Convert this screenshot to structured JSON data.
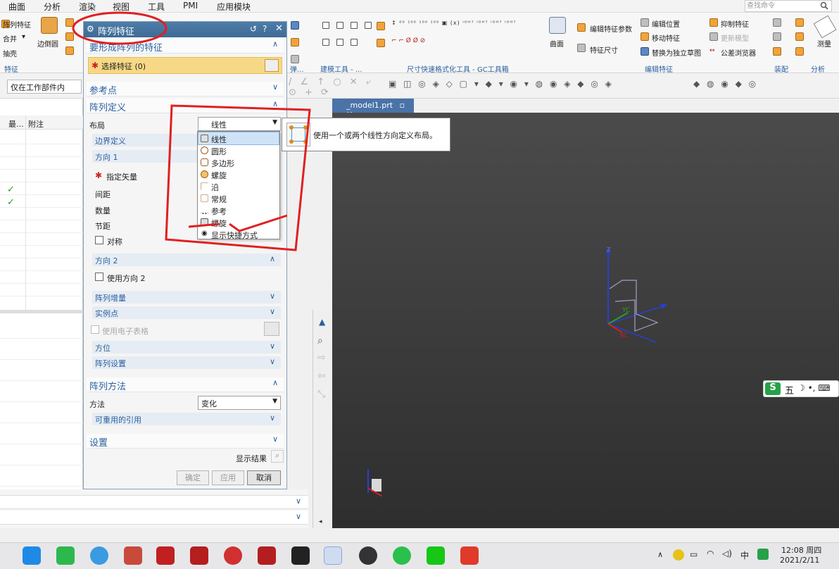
{
  "menubar": {
    "items": [
      "曲面",
      "分析",
      "渲染",
      "视图",
      "工具",
      "PMI",
      "应用模块"
    ],
    "search_placeholder": "查找命令"
  },
  "ribbon": {
    "feature_items": [
      "阵列特征",
      "合并",
      "抽壳"
    ],
    "edge_blend": "边倒圆",
    "group_feature": "特征",
    "group_synchronous": "弹...",
    "group_modeling": "建模工具 - ...",
    "group_gc": "尺寸快速格式化工具 - GC工具箱",
    "surface": "曲面",
    "edit_params": "编辑特征参数",
    "feature_dims": "特征尺寸",
    "edit_position": "编辑位置",
    "move_feature": "移动特征",
    "replace_sketch": "替换为独立草图",
    "suppress": "抑制特征",
    "update_model": "更新模型",
    "tolerance_browser": "公差浏览器",
    "group_edit_feature": "编辑特征",
    "group_assembly": "装配",
    "group_analysis": "分析",
    "measure": "测量"
  },
  "filter": {
    "value": "仅在工作部件内"
  },
  "nav": {
    "col_last": "最...",
    "col_note": "附注"
  },
  "dialog": {
    "title": "阵列特征",
    "sec_features": "要形成阵列的特征",
    "select_feature": "选择特征 (0)",
    "sec_reference": "参考点",
    "sec_definition": "阵列定义",
    "layout_label": "布局",
    "layout_value": "线性",
    "boundary": "边界定义",
    "direction1": "方向 1",
    "specify_vector": "指定矢量",
    "spacing": "间距",
    "count": "数量",
    "pitch": "节距",
    "symmetric": "对称",
    "direction2": "方向 2",
    "use_dir2": "使用方向 2",
    "increment": "阵列增量",
    "instance_point": "实例点",
    "use_spreadsheet": "使用电子表格",
    "orientation": "方位",
    "pattern_settings": "阵列设置",
    "sec_method": "阵列方法",
    "method_label": "方法",
    "method_value": "变化",
    "reusable_refs": "可重用的引用",
    "sec_settings": "设置",
    "show_result": "显示结果",
    "ok": "确定",
    "apply": "应用",
    "cancel": "取消"
  },
  "layout_options": [
    "线性",
    "圆形",
    "多边形",
    "螺旋",
    "沿",
    "常规",
    "参考",
    "螺旋",
    "显示快捷方式"
  ],
  "tooltip": "使用一个或两个线性方向定义布局。",
  "viewport": {
    "tab_title": "_model1.prt",
    "axis_z": "Z",
    "axis_y": "YC",
    "axis_x": "XC"
  },
  "taskbar": {
    "time": "12:08 周四",
    "date": "2021/2/11",
    "ime_lang": "中"
  },
  "ime_bar": {
    "label": "五"
  }
}
